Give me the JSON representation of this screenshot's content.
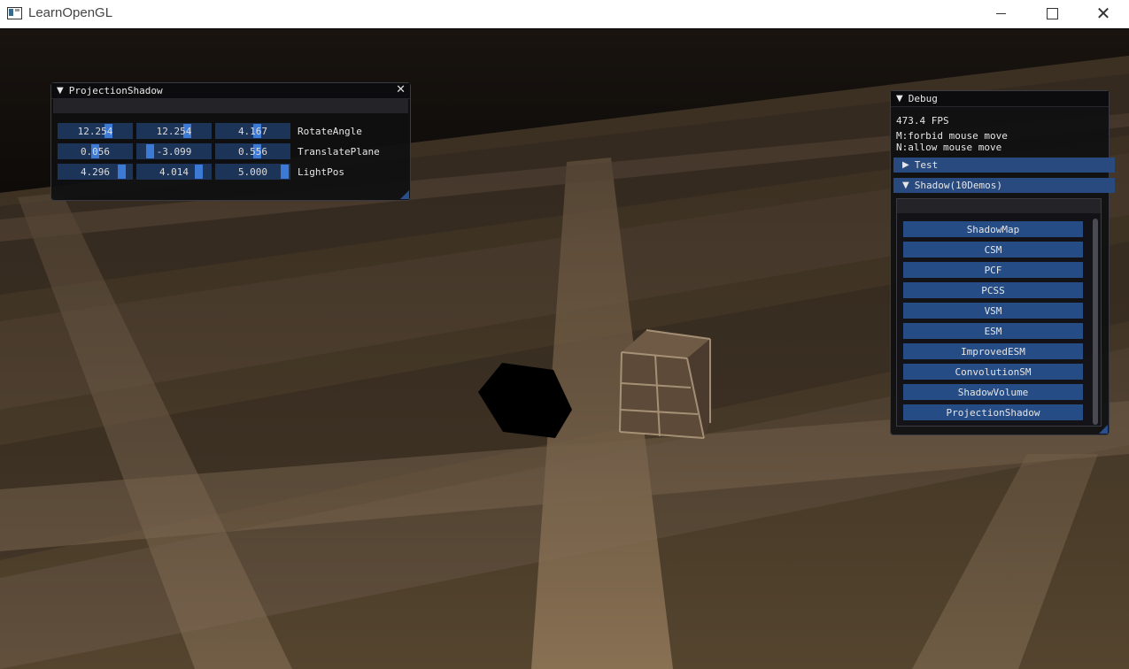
{
  "window": {
    "title": "LearnOpenGL",
    "minimize_glyph": "—",
    "close_glyph": "✕"
  },
  "projection_window": {
    "title": "ProjectionShadow",
    "collapse_glyph": "▼",
    "close_glyph": "✕",
    "rows": [
      {
        "label": "RotateAngle",
        "values": [
          "12.254",
          "12.254",
          "4.167"
        ]
      },
      {
        "label": "TranslatePlane",
        "values": [
          "0.056",
          "-3.099",
          "0.556"
        ]
      },
      {
        "label": "LightPos",
        "values": [
          "4.296",
          "4.014",
          "5.000"
        ]
      }
    ]
  },
  "debug_window": {
    "title": "Debug",
    "collapse_glyph": "▼",
    "fps": "473.4 FPS",
    "hint1": "M:forbid mouse move",
    "hint2": "N:allow mouse move",
    "headers": [
      {
        "label": "Test",
        "glyph": "▶"
      },
      {
        "label": "Shadow(10Demos)",
        "glyph": "▼"
      }
    ],
    "buttons": [
      "ShadowMap",
      "CSM",
      "PCF",
      "PCSS",
      "VSM",
      "ESM",
      "ImprovedESM",
      "ConvolutionSM",
      "ShadowVolume",
      "ProjectionShadow"
    ]
  },
  "colors": {
    "window_bg": "#0f0f11",
    "frame_bg": "#1d3459",
    "grab": "#3d7ad6",
    "button": "#254c85",
    "header": "#284a7e"
  }
}
